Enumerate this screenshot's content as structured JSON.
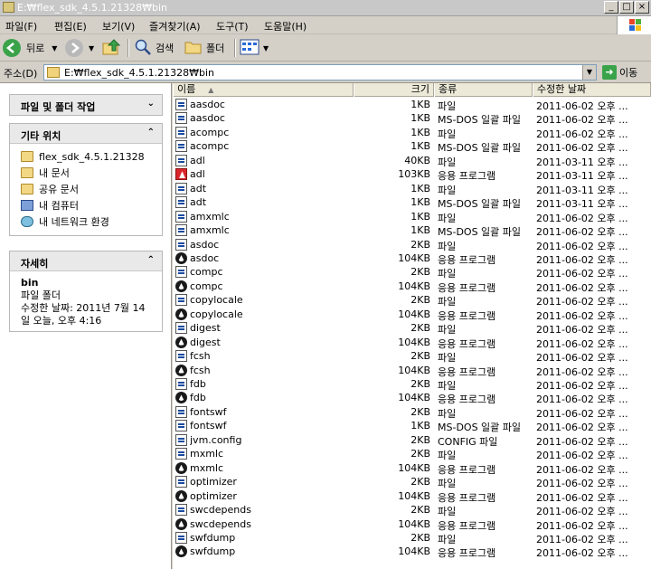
{
  "window": {
    "title": "E:₩flex_sdk_4.5.1.21328₩bin"
  },
  "menu": [
    "파일(F)",
    "편집(E)",
    "보기(V)",
    "즐겨찾기(A)",
    "도구(T)",
    "도움말(H)"
  ],
  "toolbar": {
    "back": "뒤로",
    "search": "검색",
    "folders": "폴더"
  },
  "address": {
    "label": "주소(D)",
    "value": "E:₩flex_sdk_4.5.1.21328₩bin",
    "go": "이동"
  },
  "tasks": {
    "file_folder": {
      "title": "파일 및 폴더 작업"
    },
    "other": {
      "title": "기타 위치",
      "items": [
        "flex_sdk_4.5.1.21328",
        "내 문서",
        "공유 문서",
        "내 컴퓨터",
        "내 네트워크 환경"
      ]
    },
    "details": {
      "title": "자세히",
      "name": "bin",
      "type": "파일 폴더",
      "modified_line1": "수정한 날짜: 2011년 7월 14",
      "modified_line2": "일 오늘, 오후 4:16"
    }
  },
  "columns": {
    "name": "이름",
    "size": "크기",
    "type": "종류",
    "date": "수정한 날짜"
  },
  "files": [
    {
      "name": "aasdoc",
      "size": "1KB",
      "type": "파일",
      "date": "2011-06-02 오후 ...",
      "icon": "file-icon"
    },
    {
      "name": "aasdoc",
      "size": "1KB",
      "type": "MS-DOS 일괄 파일",
      "date": "2011-06-02 오후 ...",
      "icon": "batch-icon"
    },
    {
      "name": "acompc",
      "size": "1KB",
      "type": "파일",
      "date": "2011-06-02 오후 ...",
      "icon": "file-icon"
    },
    {
      "name": "acompc",
      "size": "1KB",
      "type": "MS-DOS 일괄 파일",
      "date": "2011-06-02 오후 ...",
      "icon": "batch-icon"
    },
    {
      "name": "adl",
      "size": "40KB",
      "type": "파일",
      "date": "2011-03-11 오후 ...",
      "icon": "file-icon"
    },
    {
      "name": "adl",
      "size": "103KB",
      "type": "응용 프로그램",
      "date": "2011-03-11 오후 ...",
      "icon": "adobe-app-icon"
    },
    {
      "name": "adt",
      "size": "1KB",
      "type": "파일",
      "date": "2011-03-11 오후 ...",
      "icon": "file-icon"
    },
    {
      "name": "adt",
      "size": "1KB",
      "type": "MS-DOS 일괄 파일",
      "date": "2011-03-11 오후 ...",
      "icon": "batch-icon"
    },
    {
      "name": "amxmlc",
      "size": "1KB",
      "type": "파일",
      "date": "2011-06-02 오후 ...",
      "icon": "file-icon"
    },
    {
      "name": "amxmlc",
      "size": "1KB",
      "type": "MS-DOS 일괄 파일",
      "date": "2011-06-02 오후 ...",
      "icon": "batch-icon"
    },
    {
      "name": "asdoc",
      "size": "2KB",
      "type": "파일",
      "date": "2011-06-02 오후 ...",
      "icon": "file-icon"
    },
    {
      "name": "asdoc",
      "size": "104KB",
      "type": "응용 프로그램",
      "date": "2011-06-02 오후 ...",
      "icon": "app-icon"
    },
    {
      "name": "compc",
      "size": "2KB",
      "type": "파일",
      "date": "2011-06-02 오후 ...",
      "icon": "file-icon"
    },
    {
      "name": "compc",
      "size": "104KB",
      "type": "응용 프로그램",
      "date": "2011-06-02 오후 ...",
      "icon": "app-icon"
    },
    {
      "name": "copylocale",
      "size": "2KB",
      "type": "파일",
      "date": "2011-06-02 오후 ...",
      "icon": "file-icon"
    },
    {
      "name": "copylocale",
      "size": "104KB",
      "type": "응용 프로그램",
      "date": "2011-06-02 오후 ...",
      "icon": "app-icon"
    },
    {
      "name": "digest",
      "size": "2KB",
      "type": "파일",
      "date": "2011-06-02 오후 ...",
      "icon": "file-icon"
    },
    {
      "name": "digest",
      "size": "104KB",
      "type": "응용 프로그램",
      "date": "2011-06-02 오후 ...",
      "icon": "app-icon"
    },
    {
      "name": "fcsh",
      "size": "2KB",
      "type": "파일",
      "date": "2011-06-02 오후 ...",
      "icon": "file-icon"
    },
    {
      "name": "fcsh",
      "size": "104KB",
      "type": "응용 프로그램",
      "date": "2011-06-02 오후 ...",
      "icon": "app-icon"
    },
    {
      "name": "fdb",
      "size": "2KB",
      "type": "파일",
      "date": "2011-06-02 오후 ...",
      "icon": "file-icon"
    },
    {
      "name": "fdb",
      "size": "104KB",
      "type": "응용 프로그램",
      "date": "2011-06-02 오후 ...",
      "icon": "app-icon"
    },
    {
      "name": "fontswf",
      "size": "2KB",
      "type": "파일",
      "date": "2011-06-02 오후 ...",
      "icon": "file-icon"
    },
    {
      "name": "fontswf",
      "size": "1KB",
      "type": "MS-DOS 일괄 파일",
      "date": "2011-06-02 오후 ...",
      "icon": "batch-icon"
    },
    {
      "name": "jvm.config",
      "size": "2KB",
      "type": "CONFIG 파일",
      "date": "2011-06-02 오후 ...",
      "icon": "file-icon"
    },
    {
      "name": "mxmlc",
      "size": "2KB",
      "type": "파일",
      "date": "2011-06-02 오후 ...",
      "icon": "file-icon"
    },
    {
      "name": "mxmlc",
      "size": "104KB",
      "type": "응용 프로그램",
      "date": "2011-06-02 오후 ...",
      "icon": "app-icon"
    },
    {
      "name": "optimizer",
      "size": "2KB",
      "type": "파일",
      "date": "2011-06-02 오후 ...",
      "icon": "file-icon"
    },
    {
      "name": "optimizer",
      "size": "104KB",
      "type": "응용 프로그램",
      "date": "2011-06-02 오후 ...",
      "icon": "app-icon"
    },
    {
      "name": "swcdepends",
      "size": "2KB",
      "type": "파일",
      "date": "2011-06-02 오후 ...",
      "icon": "file-icon"
    },
    {
      "name": "swcdepends",
      "size": "104KB",
      "type": "응용 프로그램",
      "date": "2011-06-02 오후 ...",
      "icon": "app-icon"
    },
    {
      "name": "swfdump",
      "size": "2KB",
      "type": "파일",
      "date": "2011-06-02 오후 ...",
      "icon": "file-icon"
    },
    {
      "name": "swfdump",
      "size": "104KB",
      "type": "응용 프로그램",
      "date": "2011-06-02 오후 ...",
      "icon": "app-icon"
    }
  ]
}
